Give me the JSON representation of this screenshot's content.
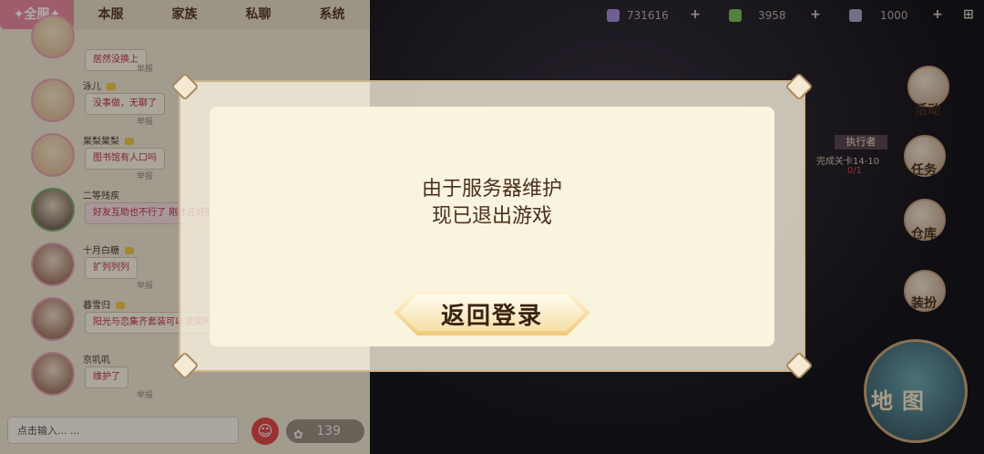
{
  "chat": {
    "tabs": [
      "✦全服✦",
      "本服",
      "家族",
      "私聊",
      "系统"
    ],
    "messages": [
      {
        "user": "",
        "text": "居然没换上",
        "report": "举报"
      },
      {
        "user": "泳儿",
        "text": "没事做，无聊了",
        "report": "举报"
      },
      {
        "user": "棠梨棠梨",
        "text": "图书馆有人口吗",
        "report": "举报"
      },
      {
        "user": "二等残疾",
        "text": "好友互助也不行了 刚才还好的",
        "report": ""
      },
      {
        "user": "十月白糖",
        "text": "扩列列列",
        "report": "举报"
      },
      {
        "user": "暮雪归",
        "text": "阳光与恋集齐套装可以领奖吗",
        "report": ""
      },
      {
        "user": "京叽叽",
        "text": "维护了",
        "report": "举报"
      }
    ],
    "input_placeholder": "点击输入... ...",
    "flower_count": "139"
  },
  "resources": [
    {
      "value": "731616",
      "color": "#a88cd6"
    },
    {
      "value": "3958",
      "color": "#7dbb5a"
    },
    {
      "value": "1000",
      "color": "#a7a7c6"
    }
  ],
  "side_menu": {
    "activity": "活动",
    "task": "任务",
    "warehouse": "仓库",
    "dressup": "装扮",
    "map": "地图"
  },
  "quest": {
    "title": "执行者",
    "desc": "完成关卡14-10",
    "progress": "0/1"
  },
  "dialog": {
    "line1": "由于服务器维护",
    "line2": "现已退出游戏",
    "button": "返回登录"
  }
}
